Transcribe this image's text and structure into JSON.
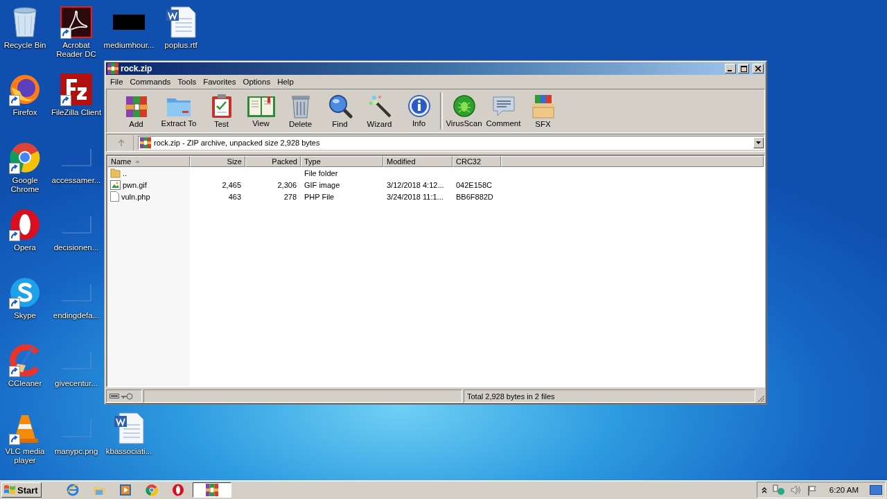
{
  "desktop_icons": [
    {
      "label": "Recycle Bin",
      "kind": "recycle",
      "shortcut": false
    },
    {
      "label": "Acrobat Reader DC",
      "kind": "acrobat",
      "shortcut": true
    },
    {
      "label": "mediumhour...",
      "kind": "dark",
      "shortcut": false
    },
    {
      "label": "poplus.rtf",
      "kind": "word",
      "shortcut": false
    },
    {
      "label": "Firefox",
      "kind": "firefox",
      "shortcut": true
    },
    {
      "label": "FileZilla Client",
      "kind": "filezilla",
      "shortcut": true
    },
    {
      "label": "Google Chrome",
      "kind": "chrome",
      "shortcut": true
    },
    {
      "label": "accessamer...",
      "kind": "blank",
      "shortcut": false
    },
    {
      "label": "Opera",
      "kind": "opera",
      "shortcut": true
    },
    {
      "label": "decisionen...",
      "kind": "blank",
      "shortcut": false
    },
    {
      "label": "Skype",
      "kind": "skype",
      "shortcut": true
    },
    {
      "label": "endingdefa...",
      "kind": "blank",
      "shortcut": false
    },
    {
      "label": "CCleaner",
      "kind": "ccleaner",
      "shortcut": true
    },
    {
      "label": "givecentur...",
      "kind": "blank",
      "shortcut": false
    },
    {
      "label": "VLC media player",
      "kind": "vlc",
      "shortcut": true
    },
    {
      "label": "manypc.png",
      "kind": "blank",
      "shortcut": false
    },
    {
      "label": "kbassociati...",
      "kind": "word",
      "shortcut": false
    }
  ],
  "window": {
    "title": "rock.zip",
    "menu": [
      "File",
      "Commands",
      "Tools",
      "Favorites",
      "Options",
      "Help"
    ],
    "toolbar": [
      {
        "label": "Add",
        "kind": "add"
      },
      {
        "label": "Extract To",
        "kind": "extract"
      },
      {
        "label": "Test",
        "kind": "test"
      },
      {
        "label": "View",
        "kind": "view"
      },
      {
        "label": "Delete",
        "kind": "delete"
      },
      {
        "label": "Find",
        "kind": "find"
      },
      {
        "label": "Wizard",
        "kind": "wizard"
      },
      {
        "label": "Info",
        "kind": "info"
      },
      {
        "label": "VirusScan",
        "kind": "virusscan"
      },
      {
        "label": "Comment",
        "kind": "comment"
      },
      {
        "label": "SFX",
        "kind": "sfx"
      }
    ],
    "address": "rock.zip - ZIP archive, unpacked size 2,928 bytes",
    "columns": [
      {
        "label": "Name",
        "sorted": true
      },
      {
        "label": "Size",
        "sorted": false
      },
      {
        "label": "Packed",
        "sorted": false
      },
      {
        "label": "Type",
        "sorted": false
      },
      {
        "label": "Modified",
        "sorted": false
      },
      {
        "label": "CRC32",
        "sorted": false
      }
    ],
    "rows": [
      {
        "kind": "folder",
        "name": "..",
        "size": "",
        "packed": "",
        "type": "File folder",
        "modified": "",
        "crc32": ""
      },
      {
        "kind": "image",
        "name": "pwn.gif",
        "size": "2,465",
        "packed": "2,306",
        "type": "GIF image",
        "modified": "3/12/2018 4:12...",
        "crc32": "042E158C"
      },
      {
        "kind": "file",
        "name": "vuln.php",
        "size": "463",
        "packed": "278",
        "type": "PHP File",
        "modified": "3/24/2018 11:1...",
        "crc32": "BB6F882D"
      }
    ],
    "status_bar": "Total 2,928 bytes in 2 files"
  },
  "taskbar": {
    "start": "Start",
    "apps": [
      {
        "kind": "ie",
        "selected": false
      },
      {
        "kind": "explorer",
        "selected": false
      },
      {
        "kind": "media",
        "selected": false
      },
      {
        "kind": "chrome",
        "selected": false
      },
      {
        "kind": "opera",
        "selected": false
      },
      {
        "kind": "winrar",
        "selected": true
      }
    ],
    "clock": "6:20 AM"
  }
}
